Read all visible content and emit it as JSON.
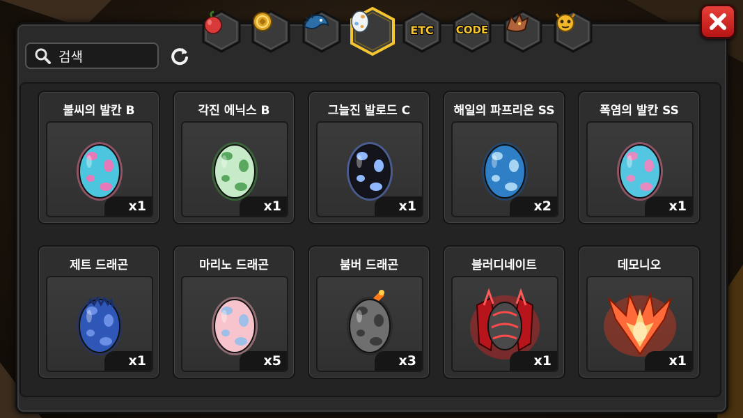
{
  "search": {
    "placeholder": "검색"
  },
  "tabs": [
    {
      "kind": "fruit-icon"
    },
    {
      "kind": "gold-coin-icon"
    },
    {
      "kind": "dragon-head-icon"
    },
    {
      "kind": "egg-icon",
      "active": true
    },
    {
      "kind": "text",
      "label": "ETC"
    },
    {
      "kind": "text",
      "label": "CODE"
    },
    {
      "kind": "demon-dragon-icon"
    },
    {
      "kind": "face-icon"
    }
  ],
  "items": [
    {
      "name": "불씨의 발칸 B",
      "count": "x1",
      "art": "egg",
      "base": "#4cc6de",
      "spot": "#e879b8",
      "glow": "#d9708f"
    },
    {
      "name": "각진 에닉스 B",
      "count": "x1",
      "art": "egg",
      "base": "#c7ebc9",
      "spot": "#5aa860",
      "glow": "#3f8a3f"
    },
    {
      "name": "그늘진 발로드 C",
      "count": "x1",
      "art": "egg",
      "base": "#14141c",
      "spot": "#8fb8ff",
      "glow": "#5a7ad8"
    },
    {
      "name": "해일의 파프리온 SS",
      "count": "x2",
      "art": "egg",
      "base": "#2f7fc6",
      "spot": "#a8d4f4",
      "glow": "#1a4f8c"
    },
    {
      "name": "폭염의 발칸 SS",
      "count": "x1",
      "art": "egg",
      "base": "#55c6e2",
      "spot": "#e68ac2",
      "glow": "#d9708f"
    },
    {
      "name": "제트 드래곤",
      "count": "x1",
      "art": "egg",
      "base": "#2f57b8",
      "spot": "#6a8fe4",
      "glow": "#1f3478"
    },
    {
      "name": "마리노 드래곤",
      "count": "x5",
      "art": "egg",
      "base": "#f7c3cc",
      "spot": "#9ec0e8",
      "glow": "#d99aa6"
    },
    {
      "name": "붐버 드래곤",
      "count": "x3",
      "art": "egg",
      "base": "#6f6f6f",
      "spot": "#3b3b3b",
      "glow": "#222222"
    },
    {
      "name": "블러디네이트",
      "count": "x1",
      "art": "red-armor",
      "base": "#b8141c",
      "spot": "#ff5b5b",
      "glow": "#ff2020"
    },
    {
      "name": "데모니오",
      "count": "x1",
      "art": "flame-armor",
      "base": "#ff6a3a",
      "spot": "#ffd07a",
      "glow": "#ff3a1a"
    }
  ],
  "colors": {
    "accent_gold": "#f4c531",
    "close_red": "#d42a24",
    "panel": "#2a2a2a"
  }
}
